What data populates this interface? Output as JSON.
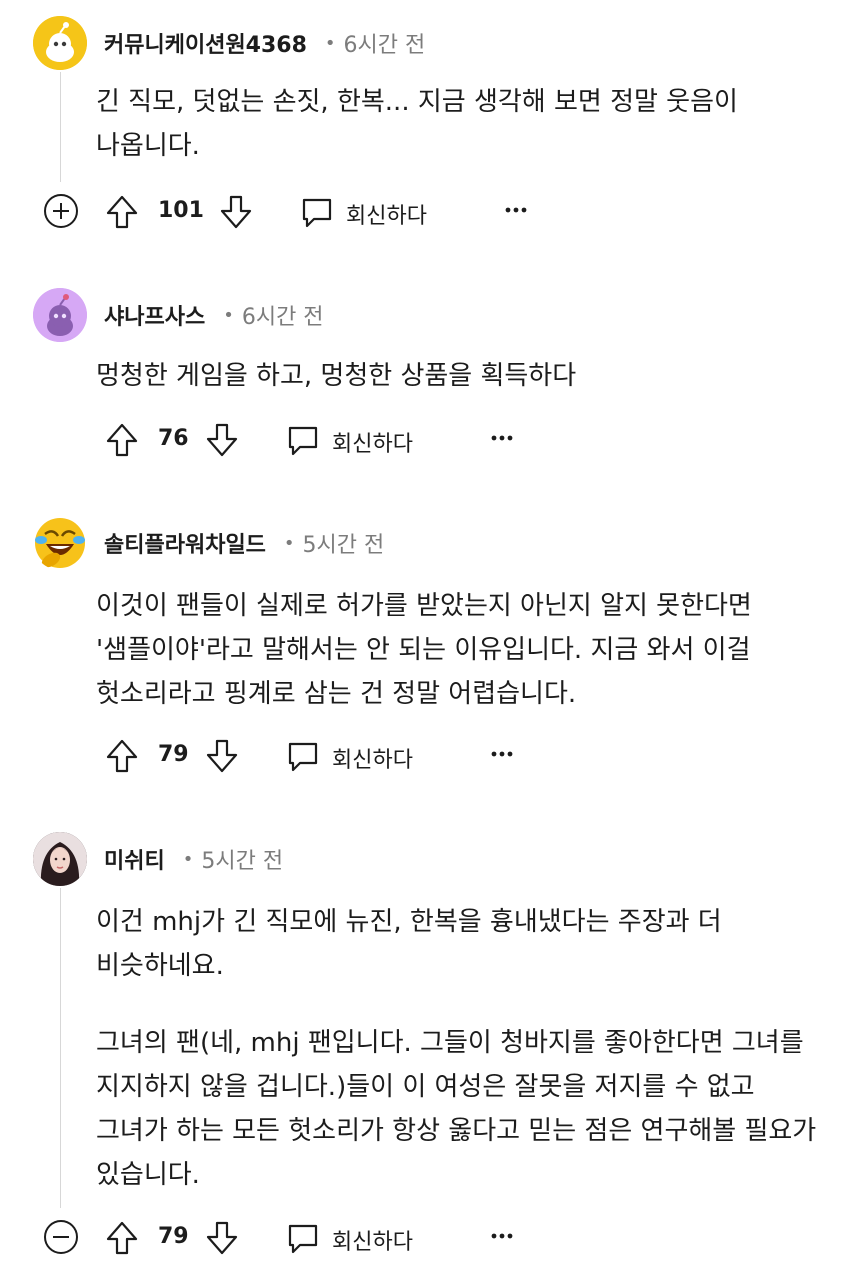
{
  "comments": [
    {
      "username": "커뮤니케이션원4368",
      "time": "6시간 전",
      "body": [
        "긴 직모, 덧없는 손짓, 한복... 지금 생각해 보면 정말 웃음이 나옵니다."
      ],
      "votes": "101",
      "reply_label": "회신하다",
      "toggle": "expand",
      "avatar": "snoo-yellow"
    },
    {
      "username": "샤나프사스",
      "time": "6시간 전",
      "body": [
        "멍청한 게임을 하고, 멍청한 상품을 획득하다"
      ],
      "votes": "76",
      "reply_label": "회신하다",
      "avatar": "snoo-purple"
    },
    {
      "username": "솔티플라워차일드",
      "time": "5시간 전",
      "body": [
        "이것이 팬들이 실제로 허가를 받았는지 아닌지 알지 못한다면 '샘플이야'라고 말해서는 안 되는 이유입니다. 지금 와서 이걸 헛소리라고 핑계로 삼는 건 정말 어렵습니다."
      ],
      "votes": "79",
      "reply_label": "회신하다",
      "avatar": "laughing-emoji"
    },
    {
      "username": "미쉬티",
      "time": "5시간 전",
      "body": [
        "이건 mhj가 긴 직모에 뉴진, 한복을 흉내냈다는 주장과 더 비슷하네요.",
        "그녀의 팬(네, mhj 팬입니다. 그들이 청바지를 좋아한다면 그녀를 지지하지 않을 겁니다.)들이 이 여성은 잘못을 저지를 수 없고 그녀가 하는 모든 헛소리가 항상 옳다고 믿는 점은 연구해볼 필요가 있습니다."
      ],
      "votes": "79",
      "reply_label": "회신하다",
      "toggle": "collapse",
      "avatar": "user-photo"
    }
  ],
  "colors": {
    "text": "#1c1c1c",
    "meta": "#7c7c7c",
    "thread_line": "#d7d7d7",
    "avatar_yellow": "#f5c518",
    "avatar_purple": "#d6a8f5"
  }
}
